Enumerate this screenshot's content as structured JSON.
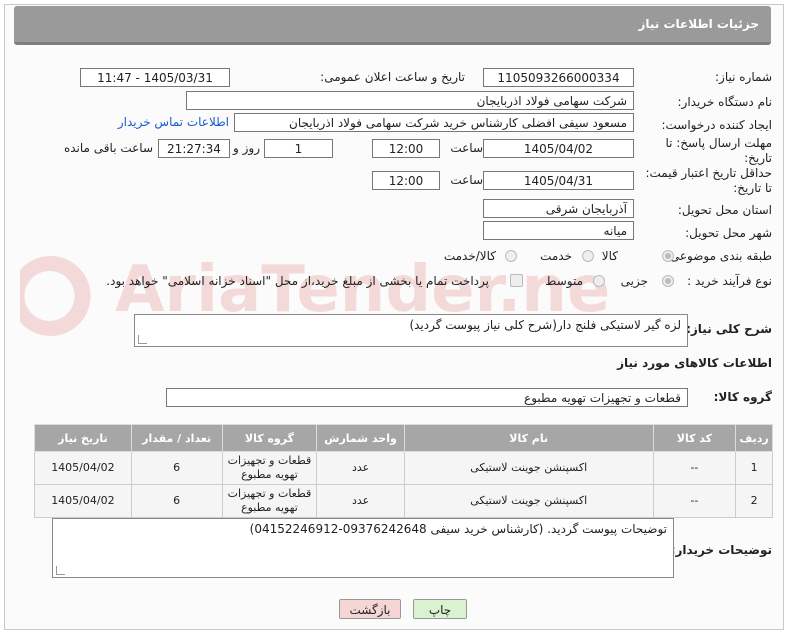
{
  "title": "جزئیات اطلاعات نیاز",
  "fields": {
    "need_number_label": "شماره نیاز:",
    "need_number": "1105093266000334",
    "announce_label": "تاریخ و ساعت اعلان عمومی:",
    "announce_value": "1405/03/31 - 11:47",
    "buyer_org_label": "نام دستگاه خریدار:",
    "buyer_org": "شرکت سهامی فولاد اذربایجان",
    "creator_label": "ایجاد کننده درخواست:",
    "creator": "مسعود سیفی افضلی کارشناس خرید شرکت سهامی فولاد اذربایجان",
    "contact_link": "اطلاعات تماس خریدار",
    "deadline_label": "مهلت ارسال پاسخ: تا تاریخ:",
    "deadline_date": "1405/04/02",
    "time_label": "ساعت",
    "deadline_time": "12:00",
    "days_value": "1",
    "days_label": "روز و",
    "remaining_time": "21:27:34",
    "remaining_label": "ساعت باقی مانده",
    "price_valid_label": "حداقل تاریخ اعتبار قیمت: تا تاریخ:",
    "price_valid_date": "1405/04/31",
    "price_valid_time": "12:00",
    "province_label": "استان محل تحویل:",
    "province": "آذربایجان شرقی",
    "city_label": "شهر محل تحویل:",
    "city": "میانه",
    "category_label": "طبقه بندی موضوعی:",
    "category_options": [
      "کالا",
      "خدمت",
      "کالا/خدمت"
    ],
    "purchase_type_label": "نوع فرآیند خرید :",
    "purchase_options": [
      "جزیی",
      "متوسط"
    ],
    "payment_note": "پرداخت تمام یا بخشی از مبلغ خرید،از محل \"اسناد خزانه اسلامی\" خواهد بود."
  },
  "description": {
    "label": "شرح کلی نیاز:",
    "text": "لزه گیر لاستیکی فلنج دار(شرح کلی نیاز پیوست گردید)"
  },
  "goods_info_header": "اطلاعات کالاهای مورد نیاز",
  "goods_group": {
    "label": "گروه کالا:",
    "value": "قطعات و تجهیزات تهویه مطبوع"
  },
  "table": {
    "headers": [
      "ردیف",
      "کد کالا",
      "نام کالا",
      "واحد شمارش",
      "گروه کالا",
      "تعداد / مقدار",
      "تاریخ نیاز"
    ],
    "rows": [
      {
        "row": "1",
        "code": "--",
        "name": "اکسپنشن جوینت لاستیکی",
        "unit": "عدد",
        "group": "قطعات و تجهیزات تهویه مطبوع",
        "qty": "6",
        "date": "1405/04/02"
      },
      {
        "row": "2",
        "code": "--",
        "name": "اکسپنشن جوینت لاستیکی",
        "unit": "عدد",
        "group": "قطعات و تجهیزات تهویه مطبوع",
        "qty": "6",
        "date": "1405/04/02"
      }
    ]
  },
  "buyer_notes": {
    "label": "توضیحات خریدار:",
    "text": "توضیحات پیوست گردید. (کارشناس خرید سیفی 09376242648-04152246912)"
  },
  "buttons": {
    "print": "چاپ",
    "back": "بازگشت"
  },
  "watermark": "AriaTender.net",
  "colors": {
    "titlebar": "#9a9a9a",
    "link": "#1a5bd1",
    "print_btn": "#d9f2d0",
    "back_btn": "#f6d5d5"
  }
}
